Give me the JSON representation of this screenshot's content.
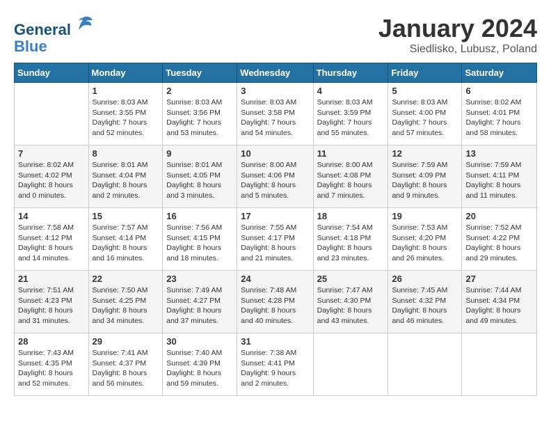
{
  "logo": {
    "line1": "General",
    "line2": "Blue"
  },
  "title": "January 2024",
  "location": "Siedlisko, Lubusz, Poland",
  "days_header": [
    "Sunday",
    "Monday",
    "Tuesday",
    "Wednesday",
    "Thursday",
    "Friday",
    "Saturday"
  ],
  "weeks": [
    [
      {
        "day": "",
        "info": ""
      },
      {
        "day": "1",
        "info": "Sunrise: 8:03 AM\nSunset: 3:55 PM\nDaylight: 7 hours\nand 52 minutes."
      },
      {
        "day": "2",
        "info": "Sunrise: 8:03 AM\nSunset: 3:56 PM\nDaylight: 7 hours\nand 53 minutes."
      },
      {
        "day": "3",
        "info": "Sunrise: 8:03 AM\nSunset: 3:58 PM\nDaylight: 7 hours\nand 54 minutes."
      },
      {
        "day": "4",
        "info": "Sunrise: 8:03 AM\nSunset: 3:59 PM\nDaylight: 7 hours\nand 55 minutes."
      },
      {
        "day": "5",
        "info": "Sunrise: 8:03 AM\nSunset: 4:00 PM\nDaylight: 7 hours\nand 57 minutes."
      },
      {
        "day": "6",
        "info": "Sunrise: 8:02 AM\nSunset: 4:01 PM\nDaylight: 7 hours\nand 58 minutes."
      }
    ],
    [
      {
        "day": "7",
        "info": "Sunrise: 8:02 AM\nSunset: 4:02 PM\nDaylight: 8 hours\nand 0 minutes."
      },
      {
        "day": "8",
        "info": "Sunrise: 8:01 AM\nSunset: 4:04 PM\nDaylight: 8 hours\nand 2 minutes."
      },
      {
        "day": "9",
        "info": "Sunrise: 8:01 AM\nSunset: 4:05 PM\nDaylight: 8 hours\nand 3 minutes."
      },
      {
        "day": "10",
        "info": "Sunrise: 8:00 AM\nSunset: 4:06 PM\nDaylight: 8 hours\nand 5 minutes."
      },
      {
        "day": "11",
        "info": "Sunrise: 8:00 AM\nSunset: 4:08 PM\nDaylight: 8 hours\nand 7 minutes."
      },
      {
        "day": "12",
        "info": "Sunrise: 7:59 AM\nSunset: 4:09 PM\nDaylight: 8 hours\nand 9 minutes."
      },
      {
        "day": "13",
        "info": "Sunrise: 7:59 AM\nSunset: 4:11 PM\nDaylight: 8 hours\nand 11 minutes."
      }
    ],
    [
      {
        "day": "14",
        "info": "Sunrise: 7:58 AM\nSunset: 4:12 PM\nDaylight: 8 hours\nand 14 minutes."
      },
      {
        "day": "15",
        "info": "Sunrise: 7:57 AM\nSunset: 4:14 PM\nDaylight: 8 hours\nand 16 minutes."
      },
      {
        "day": "16",
        "info": "Sunrise: 7:56 AM\nSunset: 4:15 PM\nDaylight: 8 hours\nand 18 minutes."
      },
      {
        "day": "17",
        "info": "Sunrise: 7:55 AM\nSunset: 4:17 PM\nDaylight: 8 hours\nand 21 minutes."
      },
      {
        "day": "18",
        "info": "Sunrise: 7:54 AM\nSunset: 4:18 PM\nDaylight: 8 hours\nand 23 minutes."
      },
      {
        "day": "19",
        "info": "Sunrise: 7:53 AM\nSunset: 4:20 PM\nDaylight: 8 hours\nand 26 minutes."
      },
      {
        "day": "20",
        "info": "Sunrise: 7:52 AM\nSunset: 4:22 PM\nDaylight: 8 hours\nand 29 minutes."
      }
    ],
    [
      {
        "day": "21",
        "info": "Sunrise: 7:51 AM\nSunset: 4:23 PM\nDaylight: 8 hours\nand 31 minutes."
      },
      {
        "day": "22",
        "info": "Sunrise: 7:50 AM\nSunset: 4:25 PM\nDaylight: 8 hours\nand 34 minutes."
      },
      {
        "day": "23",
        "info": "Sunrise: 7:49 AM\nSunset: 4:27 PM\nDaylight: 8 hours\nand 37 minutes."
      },
      {
        "day": "24",
        "info": "Sunrise: 7:48 AM\nSunset: 4:28 PM\nDaylight: 8 hours\nand 40 minutes."
      },
      {
        "day": "25",
        "info": "Sunrise: 7:47 AM\nSunset: 4:30 PM\nDaylight: 8 hours\nand 43 minutes."
      },
      {
        "day": "26",
        "info": "Sunrise: 7:45 AM\nSunset: 4:32 PM\nDaylight: 8 hours\nand 46 minutes."
      },
      {
        "day": "27",
        "info": "Sunrise: 7:44 AM\nSunset: 4:34 PM\nDaylight: 8 hours\nand 49 minutes."
      }
    ],
    [
      {
        "day": "28",
        "info": "Sunrise: 7:43 AM\nSunset: 4:35 PM\nDaylight: 8 hours\nand 52 minutes."
      },
      {
        "day": "29",
        "info": "Sunrise: 7:41 AM\nSunset: 4:37 PM\nDaylight: 8 hours\nand 56 minutes."
      },
      {
        "day": "30",
        "info": "Sunrise: 7:40 AM\nSunset: 4:39 PM\nDaylight: 8 hours\nand 59 minutes."
      },
      {
        "day": "31",
        "info": "Sunrise: 7:38 AM\nSunset: 4:41 PM\nDaylight: 9 hours\nand 2 minutes."
      },
      {
        "day": "",
        "info": ""
      },
      {
        "day": "",
        "info": ""
      },
      {
        "day": "",
        "info": ""
      }
    ]
  ]
}
